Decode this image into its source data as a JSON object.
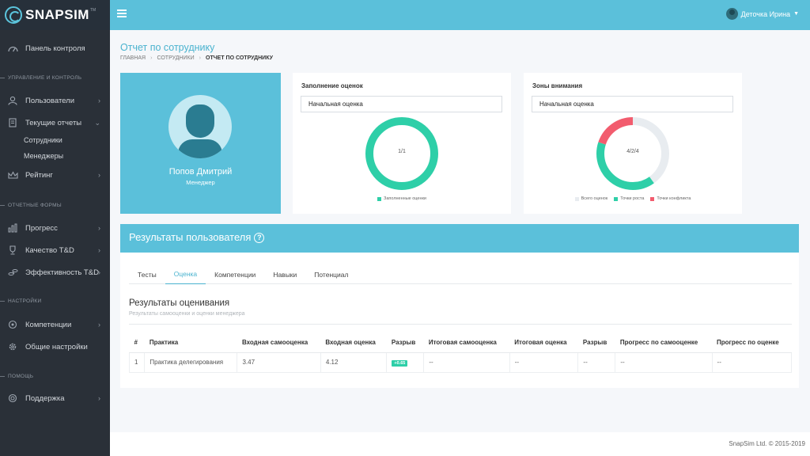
{
  "app": {
    "logo": "SNAPSIM",
    "logo_tm": "TM"
  },
  "sidebar": {
    "dashboard": "Панель контроля",
    "section_manage": "УПРАВЛЕНИЕ И КОНТРОЛЬ",
    "users": "Пользователи",
    "current_reports": "Текущие отчеты",
    "employees": "Сотрудники",
    "managers": "Менеджеры",
    "rating": "Рейтинг",
    "section_reports": "ОТЧЕТНЫЕ ФОРМЫ",
    "progress": "Прогресс",
    "quality": "Качество T&D",
    "efficiency": "Эффективность T&D",
    "section_settings": "НАСТРОЙКИ",
    "competencies": "Компетенции",
    "general_settings": "Общие настройки",
    "section_help": "ПОМОЩЬ",
    "support": "Поддержка"
  },
  "topbar": {
    "user_name": "Деточка Ирина"
  },
  "page": {
    "title": "Отчет по сотруднику",
    "breadcrumb": [
      "ГЛАВНАЯ",
      "СОТРУДНИКИ",
      "ОТЧЕТ ПО СОТРУДНИКУ"
    ]
  },
  "profile": {
    "name": "Попов Дмитрий",
    "role": "Менеджер"
  },
  "fill_card": {
    "title": "Заполнение оценок",
    "select_value": "Начальная оценка",
    "center_label": "1/1",
    "legend": [
      "Заполненные оценки"
    ],
    "color_filled": "#2ecfa8",
    "filled_fraction": 1.0
  },
  "attention_card": {
    "title": "Зоны внимания",
    "select_value": "Начальная оценка",
    "center_label": "4/2/4",
    "legend": [
      "Всего оценок",
      "Точки роста",
      "Точки конфликта"
    ],
    "colors": [
      "#e8ecf0",
      "#2ecfa8",
      "#f25c6e"
    ],
    "segments": [
      0.4,
      0.4,
      0.2
    ]
  },
  "results": {
    "header": "Результаты пользователя",
    "tabs": [
      "Тесты",
      "Оценка",
      "Компетенции",
      "Навыки",
      "Потенциал"
    ],
    "active_tab": 1,
    "section_title": "Результаты оценивания",
    "section_subtitle": "Результаты самооценки и оценки менеджера",
    "columns": [
      "#",
      "Практика",
      "Входная самооценка",
      "Входная оценка",
      "Разрыв",
      "Итоговая самооценка",
      "Итоговая оценка",
      "Разрыв",
      "Прогресс по самооценке",
      "Прогресс по оценке"
    ],
    "rows": [
      [
        "1",
        "Практика делегирования",
        "3.47",
        "4.12",
        "+0.65",
        "--",
        "--",
        "--",
        "--",
        "--"
      ]
    ]
  },
  "footer": {
    "copyright": "SnapSim Ltd. © 2015-2019"
  }
}
